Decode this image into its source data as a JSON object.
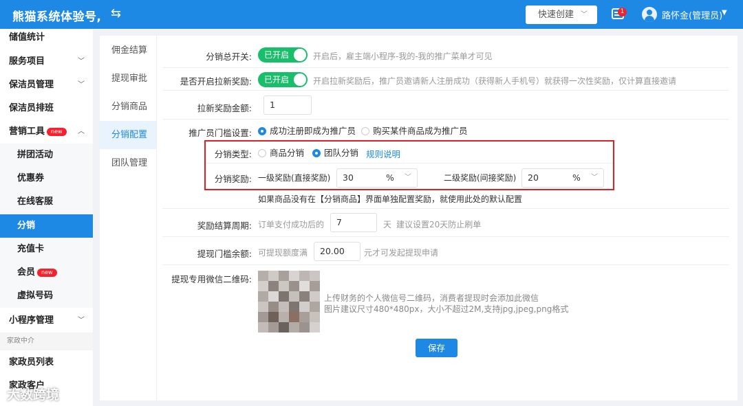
{
  "header": {
    "title": "熊猫系统体验号,",
    "swap_icon": "⇆",
    "quick_create": "快速创建",
    "msg_count": "1",
    "user": "路怀金(管理员)"
  },
  "sidebar": {
    "items": [
      {
        "label": "储值统计"
      },
      {
        "label": "服务项目"
      },
      {
        "label": "保洁员管理"
      },
      {
        "label": "保洁员排班"
      },
      {
        "label": "营销工具",
        "badge": "new"
      },
      {
        "label": "拼团活动"
      },
      {
        "label": "优惠券"
      },
      {
        "label": "在线客服"
      },
      {
        "label": "分销"
      },
      {
        "label": "充值卡"
      },
      {
        "label": "会员",
        "badge": "new"
      },
      {
        "label": "虚拟号码"
      },
      {
        "label": "小程序管理"
      },
      {
        "label": "家政员列表"
      },
      {
        "label": "家政客户"
      }
    ],
    "group": "家政中介"
  },
  "tabs": [
    "佣金结算",
    "提现审批",
    "分销商品",
    "分销配置",
    "团队管理"
  ],
  "form": {
    "master_switch": {
      "label": "分销总开关:",
      "state": "已开启",
      "hint": "开启后，雇主端小程序-我的-我的推广菜单才可见"
    },
    "newuser_switch": {
      "label": "是否开启拉新奖励:",
      "state": "已开启",
      "hint": "开启拉新奖励后，推广员邀请新人注册成功（获得新人手机号）就获得一次性奖励，仅计算直接邀请"
    },
    "newuser_amount": {
      "label": "拉新奖励金额:",
      "value": "1"
    },
    "promoter_threshold": {
      "label": "推广员门槛设置:",
      "option1": "成功注册即成为推广员",
      "option2": "购买某件商品成为推广员"
    },
    "dist_type": {
      "label": "分销类型:",
      "option1": "商品分销",
      "option2": "团队分销",
      "link": "规则说明"
    },
    "dist_reward": {
      "label": "分销奖励:",
      "level1_label": "一级奖励(直接奖励)",
      "level1_value": "30",
      "level1_unit": "%",
      "level2_label": "二级奖励(间接奖励)",
      "level2_value": "20",
      "level2_unit": "%"
    },
    "reward_note": "如果商品没有在【分销商品】界面单独配置奖励，就使用此处的默认配置",
    "settle_cycle": {
      "label": "奖励结算周期:",
      "prefix": "订单支付成功后的",
      "value": "7",
      "suffix": "天",
      "hint": "建议设置20天防止刷单"
    },
    "withdraw_threshold": {
      "label": "提现门槛余额:",
      "prefix": "可提现额度满",
      "value": "20.00",
      "suffix": "元才可发起提现申请"
    },
    "qr": {
      "label": "提现专用微信二维码:",
      "line1": "上传财务的个人微信号二维码，消费者提现时会添加此微信",
      "line2": "图片建议尺寸480*480px，大小不超过2M,支持jpg,jpeg,png格式"
    },
    "save": "保存"
  },
  "watermark": "大数跨境"
}
